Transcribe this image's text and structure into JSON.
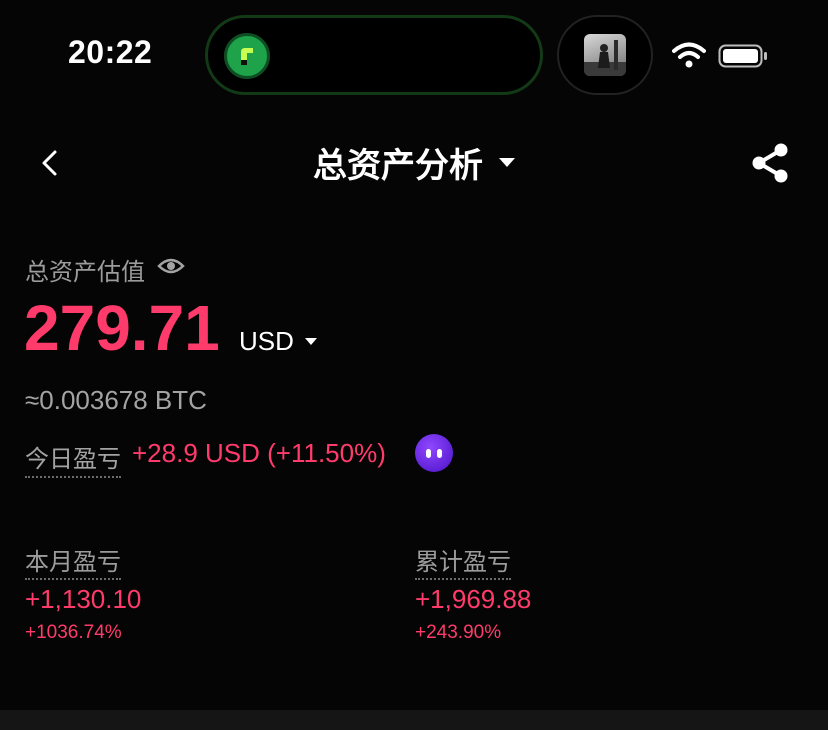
{
  "status_bar": {
    "time": "20:22"
  },
  "nav": {
    "title": "总资产分析"
  },
  "assets": {
    "label": "总资产估值",
    "total_value": "279.71",
    "currency": "USD",
    "btc_equivalent": "≈0.003678 BTC",
    "today_label": "今日盈亏",
    "today_value": "+28.9 USD (+11.50%)"
  },
  "pnl": {
    "month": {
      "label": "本月盈亏",
      "value": "+1,130.10",
      "percent": "+1036.74%"
    },
    "cumulative": {
      "label": "累计盈亏",
      "value": "+1,969.88",
      "percent": "+243.90%"
    }
  },
  "colors": {
    "accent_red": "#ff3b6b",
    "background": "#050505",
    "muted_text": "#9c9c9c",
    "mascot_purple": "#6a24e8"
  },
  "icons": [
    "back-arrow-icon",
    "dropdown-caret-icon",
    "share-icon",
    "eye-icon",
    "wifi-icon",
    "battery-icon",
    "mascot-icon"
  ]
}
